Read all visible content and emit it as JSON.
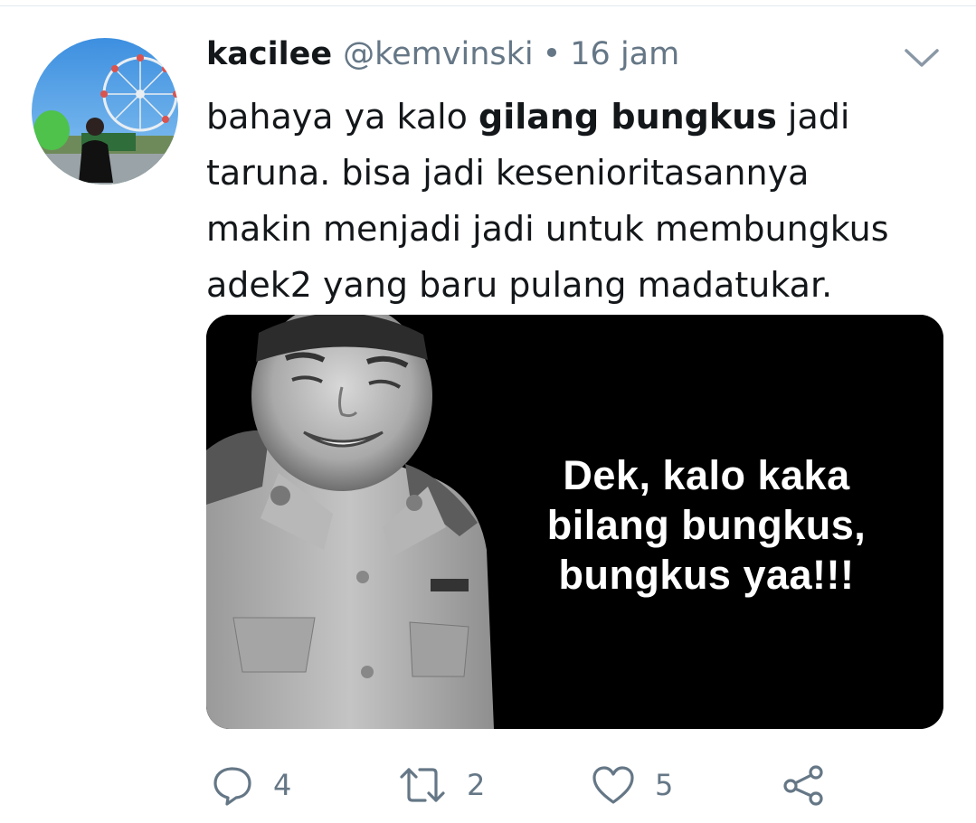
{
  "tweet": {
    "display_name": "kacilee",
    "handle": "@kemvinski",
    "separator": "•",
    "time": "16 jam",
    "text_part1": "bahaya ya kalo ",
    "text_bold": "gilang bungkus",
    "text_part2": " jadi taruna. bisa jadi kesenioritasannya makin menjadi jadi untuk membungkus adek2 yang baru pulang madatukar."
  },
  "media": {
    "caption_lines": [
      "Dek, kalo kaka",
      "bilang bungkus,",
      "bungkus yaa!!!"
    ]
  },
  "actions": {
    "reply_count": "4",
    "retweet_count": "2",
    "like_count": "5"
  },
  "icons": {
    "reply": "reply-icon",
    "retweet": "retweet-icon",
    "like": "heart-icon",
    "share": "share-icon",
    "menu": "chevron-down-icon"
  },
  "colors": {
    "text": "#14171a",
    "secondary": "#657786"
  }
}
